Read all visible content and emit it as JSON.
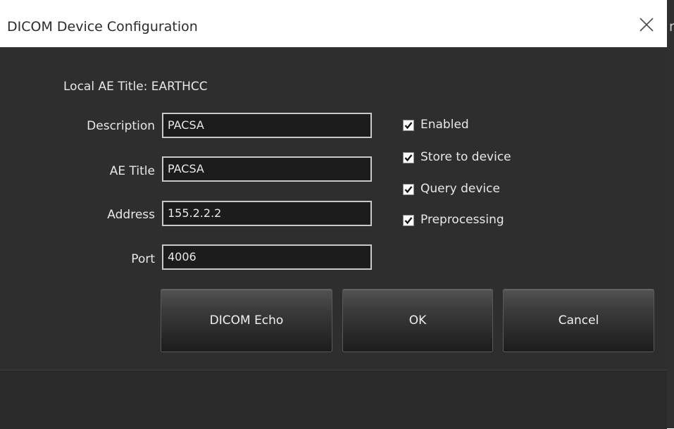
{
  "window": {
    "title": "DICOM Device Configuration",
    "edge_text": "re"
  },
  "local_ae": {
    "text": "Local AE Title: EARTHCC"
  },
  "fields": [
    {
      "label": "Description",
      "value": "PACSA"
    },
    {
      "label": "AE Title",
      "value": "PACSA"
    },
    {
      "label": "Address",
      "value": "155.2.2.2"
    },
    {
      "label": "Port",
      "value": "4006"
    }
  ],
  "checkboxes": [
    {
      "label": "Enabled",
      "checked": true
    },
    {
      "label": "Store to device",
      "checked": true
    },
    {
      "label": "Query device",
      "checked": true
    },
    {
      "label": "Preprocessing",
      "checked": true
    }
  ],
  "buttons": {
    "echo": "DICOM Echo",
    "ok": "OK",
    "cancel": "Cancel"
  },
  "colors": {
    "background": "#2e2e2e",
    "titlebar": "#ffffff",
    "field_border": "#c9c9c9",
    "text": "#e8e8e8"
  },
  "icons": {
    "close": "close-icon",
    "check": "checkmark-icon"
  }
}
